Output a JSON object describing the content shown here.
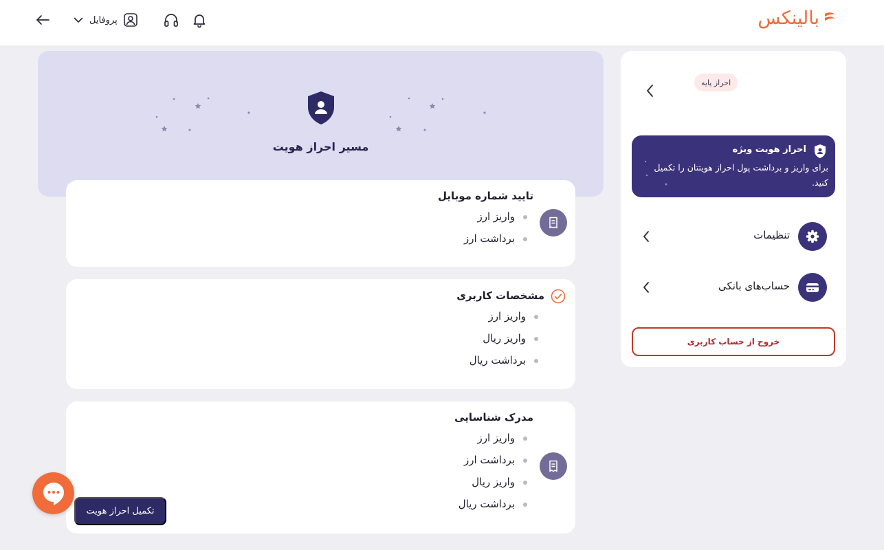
{
  "header": {
    "logo_text": "بالینکس",
    "profile_label": "پروفایل",
    "icons": [
      "back-arrow-icon",
      "chevron-down-icon",
      "user-icon",
      "headphones-icon",
      "bell-icon"
    ]
  },
  "sidebar": {
    "level_badge": "احراز پایه",
    "special": {
      "title": "احراز هویت ویژه",
      "description": "برای واریز و برداشت پول احراز هویتتان را تکمیل کنید."
    },
    "items": [
      {
        "label": "تنظیمات",
        "icon": "gear-icon"
      },
      {
        "label": "حساب‌های بانکی",
        "icon": "bank-card-icon"
      }
    ],
    "logout_label": "خروج از حساب کاربری"
  },
  "main": {
    "hero_title": "مسیر احراز هویت",
    "cards": [
      {
        "title": "تایید شماره موبایل",
        "items": [
          "واریز ارز",
          "برداشت ارز"
        ],
        "status": "pending"
      },
      {
        "title": "مشخصات کاربری",
        "items": [
          "واریز ارز",
          "واریز ریال",
          "برداشت ریال"
        ],
        "status": "done"
      },
      {
        "title": "مدرک شناسایی",
        "items": [
          "واریز ارز",
          "برداشت ارز",
          "واریز ریال",
          "برداشت ریال"
        ],
        "status": "pending"
      }
    ],
    "complete_button": "تکمیل احراز هویت"
  },
  "colors": {
    "brand_orange": "#f26b3a",
    "primary_purple": "#3a327a",
    "hero_bg": "#dedcf0",
    "page_bg": "#eeeef3",
    "logout_red": "#c0392b"
  }
}
